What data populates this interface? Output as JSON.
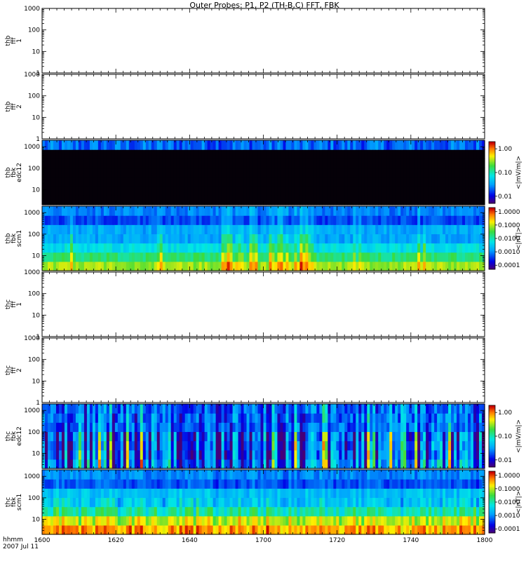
{
  "title": "Outer Probes: P1, P2 (TH-B,C) FFT, FBK",
  "x_axis": {
    "type": "time",
    "start": "16:00",
    "end": "18:00",
    "tick_labels": [
      "1600",
      "1620",
      "1640",
      "1700",
      "1720",
      "1740",
      "1800"
    ],
    "label_line1": "hhmm",
    "label_line2": "2007 Jul 11"
  },
  "chart_data": [
    {
      "type": "heatmap",
      "panel": "thb-fff1",
      "ylabel": [
        "thb",
        "fff",
        "1"
      ],
      "yscale": "log",
      "ylim": [
        1,
        1000
      ],
      "ytick_labels": [
        "1",
        "10",
        "100",
        "1000"
      ],
      "empty": true
    },
    {
      "type": "heatmap",
      "panel": "thb-fff2",
      "ylabel": [
        "thb",
        "fff",
        "2"
      ],
      "yscale": "log",
      "ylim": [
        1,
        1000
      ],
      "ytick_labels": [
        "1",
        "10",
        "100",
        "1000"
      ],
      "empty": true
    },
    {
      "type": "heatmap",
      "panel": "thb-fbk-edc12",
      "ylabel": [
        "thb",
        "fbk",
        "edc12"
      ],
      "yscale": "log",
      "ylim": [
        2,
        2000
      ],
      "ytick_labels": [
        "10",
        "100",
        "1000"
      ],
      "colorbar": {
        "label": "<|mV/m|>",
        "scale": "log",
        "range": [
          0.005,
          2.0
        ],
        "tick_labels": [
          "1.00",
          "0.10",
          "0.01"
        ]
      },
      "bands_low_to_high": [
        0.003,
        0.003,
        0.003,
        0.003,
        0.003,
        0.003,
        0.02
      ],
      "activity": "quiet"
    },
    {
      "type": "heatmap",
      "panel": "thb-fbk-scm1",
      "ylabel": [
        "thb",
        "fbk",
        "scm1"
      ],
      "yscale": "log",
      "ylim": [
        2,
        2000
      ],
      "ytick_labels": [
        "10",
        "100",
        "1000"
      ],
      "colorbar": {
        "label": "<|nT|>",
        "scale": "log",
        "range": [
          5e-05,
          2.0
        ],
        "tick_labels": [
          "1.0000",
          "0.1000",
          "0.0100",
          "0.0010",
          "0.0001"
        ]
      },
      "bands_low_to_high": [
        0.08,
        0.02,
        0.005,
        0.0015,
        0.0015,
        0.0004,
        0.0008
      ],
      "activity": "enhanced near 16:50-17:20"
    },
    {
      "type": "heatmap",
      "panel": "thc-fff1",
      "ylabel": [
        "thc",
        "fff",
        "1"
      ],
      "yscale": "log",
      "ylim": [
        1,
        1000
      ],
      "ytick_labels": [
        "1",
        "10",
        "100",
        "1000"
      ],
      "empty": true
    },
    {
      "type": "heatmap",
      "panel": "thc-fff2",
      "ylabel": [
        "thc",
        "fff",
        "2"
      ],
      "yscale": "log",
      "ylim": [
        1,
        1000
      ],
      "ytick_labels": [
        "1",
        "10",
        "100",
        "1000"
      ],
      "empty": true
    },
    {
      "type": "heatmap",
      "panel": "thc-fbk-edc12",
      "ylabel": [
        "thc",
        "fbk",
        "edc12"
      ],
      "yscale": "log",
      "ylim": [
        2,
        2000
      ],
      "ytick_labels": [
        "10",
        "100",
        "1000"
      ],
      "colorbar": {
        "label": "<|mV/m|>",
        "scale": "log",
        "range": [
          0.005,
          2.0
        ],
        "tick_labels": [
          "1.00",
          "0.10",
          "0.01"
        ]
      },
      "bands_low_to_high": [
        0.03,
        0.02,
        0.02,
        0.02,
        0.02,
        0.02,
        0.02
      ],
      "activity": "broadband bursts throughout"
    },
    {
      "type": "heatmap",
      "panel": "thc-fbk-scm1",
      "ylabel": [
        "thc",
        "fbk",
        "scm1"
      ],
      "yscale": "log",
      "ylim": [
        2,
        2000
      ],
      "ytick_labels": [
        "10",
        "100",
        "1000"
      ],
      "colorbar": {
        "label": "<|nT|>",
        "scale": "log",
        "range": [
          5e-05,
          2.0
        ],
        "tick_labels": [
          "1.0000",
          "0.1000",
          "0.0100",
          "0.0010",
          "0.0001"
        ]
      },
      "bands_low_to_high": [
        0.3,
        0.08,
        0.008,
        0.002,
        0.002,
        0.0004,
        0.0008
      ],
      "activity": "strong low-frequency power"
    }
  ]
}
